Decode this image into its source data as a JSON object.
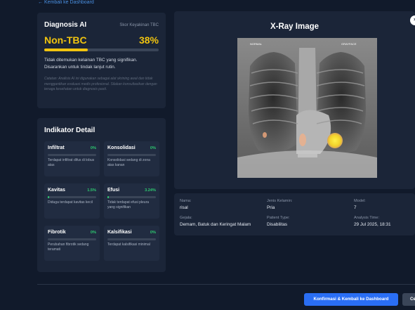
{
  "nav": {
    "back_label": "← Kembali ke Dashboard"
  },
  "diagnosis": {
    "title": "Diagnosis AI",
    "confidence_label": "Skor Keyakinan TBC",
    "result": "Non-TBC",
    "confidence_pct": "38%",
    "confidence_value": 0.38,
    "description": "Tidak ditemukan kelainan TBC yang signifikan. Disarankan untuk tindak lanjut rutin.",
    "disclaimer": "Catatan: Analisis AI ini digunakan sebagai alat skrining awal dan tidak menggantikan evaluasi medis profesional. Silakan konsultasikan dengan tenaga kesehatan untuk diagnosis pasti.",
    "accent_color": "#f1c40f"
  },
  "indicators": {
    "title": "Indikator Detail",
    "items": [
      {
        "name": "Infiltrat",
        "pct": "0%",
        "value": 0.0,
        "desc": "Terdapat infiltrat difus di lobus atas"
      },
      {
        "name": "Konsolidasi",
        "pct": "0%",
        "value": 0.0,
        "desc": "Konsolidasi sedang di zona atas kanan"
      },
      {
        "name": "Kavitas",
        "pct": "1.5%",
        "value": 0.015,
        "desc": "Diduga terdapat kavitas kecil"
      },
      {
        "name": "Efusi",
        "pct": "3.24%",
        "value": 0.0324,
        "desc": "Tidak terdapat efusi pleura yang signifikan"
      },
      {
        "name": "Fibrotik",
        "pct": "0%",
        "value": 0.0,
        "desc": "Perubahan fibrotik sedang teramati"
      },
      {
        "name": "Kalsifikasi",
        "pct": "0%",
        "value": 0.0,
        "desc": "Terdapat kalsifikasi minimal"
      }
    ],
    "color": "#2ecc71"
  },
  "xray": {
    "title": "X-Ray Image",
    "close_glyph": "×",
    "film_marks": {
      "left": "NORMAL",
      "right": "GRAYFACE"
    }
  },
  "patient": {
    "fields": [
      {
        "label": "Nama:",
        "value": "risal"
      },
      {
        "label": "Jenis Kelamin:",
        "value": "Pria"
      },
      {
        "label": "Model:",
        "value": "7"
      },
      {
        "label": "Gejala:",
        "value": "Demam, Batuk dan Keringat Malam"
      },
      {
        "label": "Patient Type:",
        "value": "Disabilitas"
      },
      {
        "label": "Analysis Time:",
        "value": "29 Jul 2025, 18:31"
      }
    ]
  },
  "actions": {
    "confirm_label": "Konfirmasi & Kembali ke Dashboard",
    "other_label": "Ce"
  }
}
